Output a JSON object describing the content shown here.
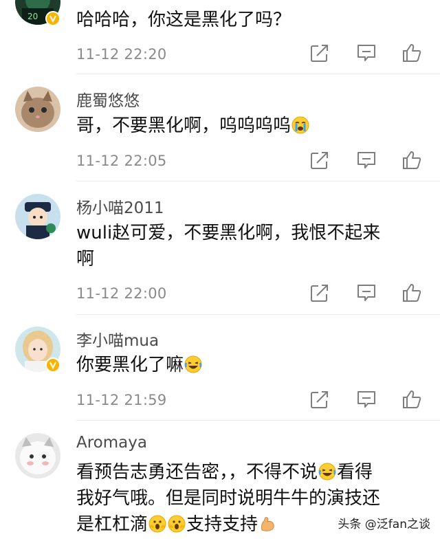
{
  "comments": [
    {
      "username": "",
      "text": "哈哈哈，你这是黑化了吗？",
      "time": "11-12 22:20",
      "verified": true,
      "avatar_icon": "green-character-avatar"
    },
    {
      "username": "鹿蜀悠悠",
      "text_before": "哥，不要黑化啊，呜呜呜呜",
      "emoji": "crying-face-emoji",
      "time": "11-12 22:05",
      "verified": false,
      "avatar_icon": "cat-avatar"
    },
    {
      "username": "杨小喵2011",
      "text_line1": "wuli赵可爱，不要黑化啊，我恨不起来",
      "text_line2": "啊",
      "time": "11-12 22:00",
      "verified": false,
      "avatar_icon": "police-cartoon-avatar"
    },
    {
      "username": "李小喵mua",
      "text_before": "你要黑化了嘛",
      "emoji": "laughing-tears-emoji",
      "time": "11-12 21:59",
      "verified": true,
      "avatar_icon": "girl-photo-avatar"
    },
    {
      "username": "Aromaya",
      "line1_before": "看预告志勇还告密，，不得不说",
      "line1_after": "看得",
      "line2": "我好气哦。但是同时说明牛牛的演技还",
      "line3_before": "是杠杠滴",
      "line3_after": "支持支持",
      "avatar_icon": "white-cat-avatar"
    }
  ],
  "watermark": "头条 @泛fan之谈",
  "icons": {
    "repost": "repost-icon",
    "comment": "comment-icon",
    "like": "thumbs-up-icon"
  }
}
